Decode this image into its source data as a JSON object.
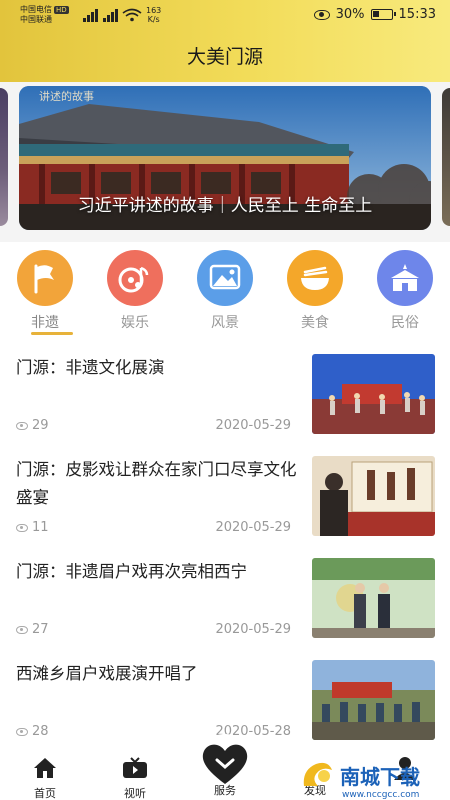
{
  "status_bar": {
    "carrier1": "中国电信",
    "carrier1_badge": "HD",
    "carrier2": "中国联通",
    "net_speed_value": "163",
    "net_speed_unit": "K/s",
    "battery": "30%",
    "time": "15:33",
    "icons": [
      "eye-icon",
      "signal-icon",
      "wifi-icon",
      "battery-icon"
    ]
  },
  "header": {
    "title": "大美门源"
  },
  "banner": {
    "caption": "习近平讲述的故事｜人民至上 生命至上",
    "tag": "讲述的故事"
  },
  "categories": [
    {
      "label": "非遗",
      "icon": "flag-icon",
      "color": "#f2a43a",
      "active": true
    },
    {
      "label": "娱乐",
      "icon": "music-icon",
      "color": "#ef6f5d",
      "active": false
    },
    {
      "label": "风景",
      "icon": "landscape-icon",
      "color": "#5b9ee8",
      "active": false
    },
    {
      "label": "美食",
      "icon": "bowl-icon",
      "color": "#f4a72a",
      "active": false
    },
    {
      "label": "民俗",
      "icon": "building-icon",
      "color": "#6e86ea",
      "active": false
    }
  ],
  "news": [
    {
      "title": "门源：非遗文化展演",
      "views": "29",
      "date": "2020-05-29"
    },
    {
      "title": "门源：皮影戏让群众在家门口尽享文化盛宴",
      "views": "11",
      "date": "2020-05-29"
    },
    {
      "title": "门源：非遗眉户戏再次亮相西宁",
      "views": "27",
      "date": "2020-05-29"
    },
    {
      "title": "西滩乡眉户戏展演开唱了",
      "views": "28",
      "date": "2020-05-28"
    }
  ],
  "bottom_nav": {
    "home": "首页",
    "video": "视听",
    "service": "服务",
    "discover": "发现",
    "mine": ""
  },
  "watermark": {
    "text": "南城下载",
    "url": "www.nccgcc.com"
  },
  "colors": {
    "header_yellow": "#f2dc59",
    "accent": "#e7b23a"
  }
}
